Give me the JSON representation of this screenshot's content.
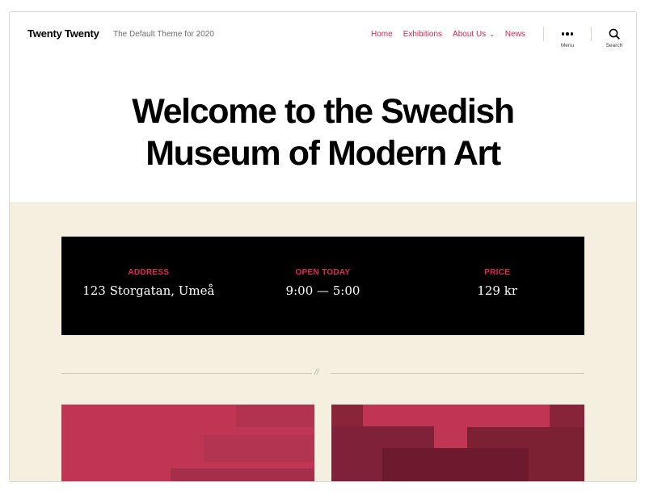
{
  "header": {
    "site_title": "Twenty Twenty",
    "site_description": "The Default Theme for 2020",
    "nav": [
      {
        "label": "Home"
      },
      {
        "label": "Exhibitions"
      },
      {
        "label": "About Us",
        "has_dropdown": true
      },
      {
        "label": "News"
      }
    ],
    "menu_label": "Menu",
    "search_label": "Search"
  },
  "hero": {
    "title_line1": "Welcome to the Swedish",
    "title_line2": "Museum of Modern Art"
  },
  "info": [
    {
      "label": "ADDRESS",
      "value": "123 Storgatan, Umeå"
    },
    {
      "label": "OPEN TODAY",
      "value": "9:00 — 5:00"
    },
    {
      "label": "PRICE",
      "value": "129 kr"
    }
  ],
  "separator": {
    "mark": "//"
  },
  "colors": {
    "accent": "#cd2653",
    "beige": "#f5efe0",
    "info_bg": "#000000",
    "tile_red": "#bf3553",
    "tile_dark": "#7a1f33"
  },
  "icons": {
    "menu": "more-dots-icon",
    "search": "search-icon",
    "dropdown": "chevron-down-icon"
  }
}
